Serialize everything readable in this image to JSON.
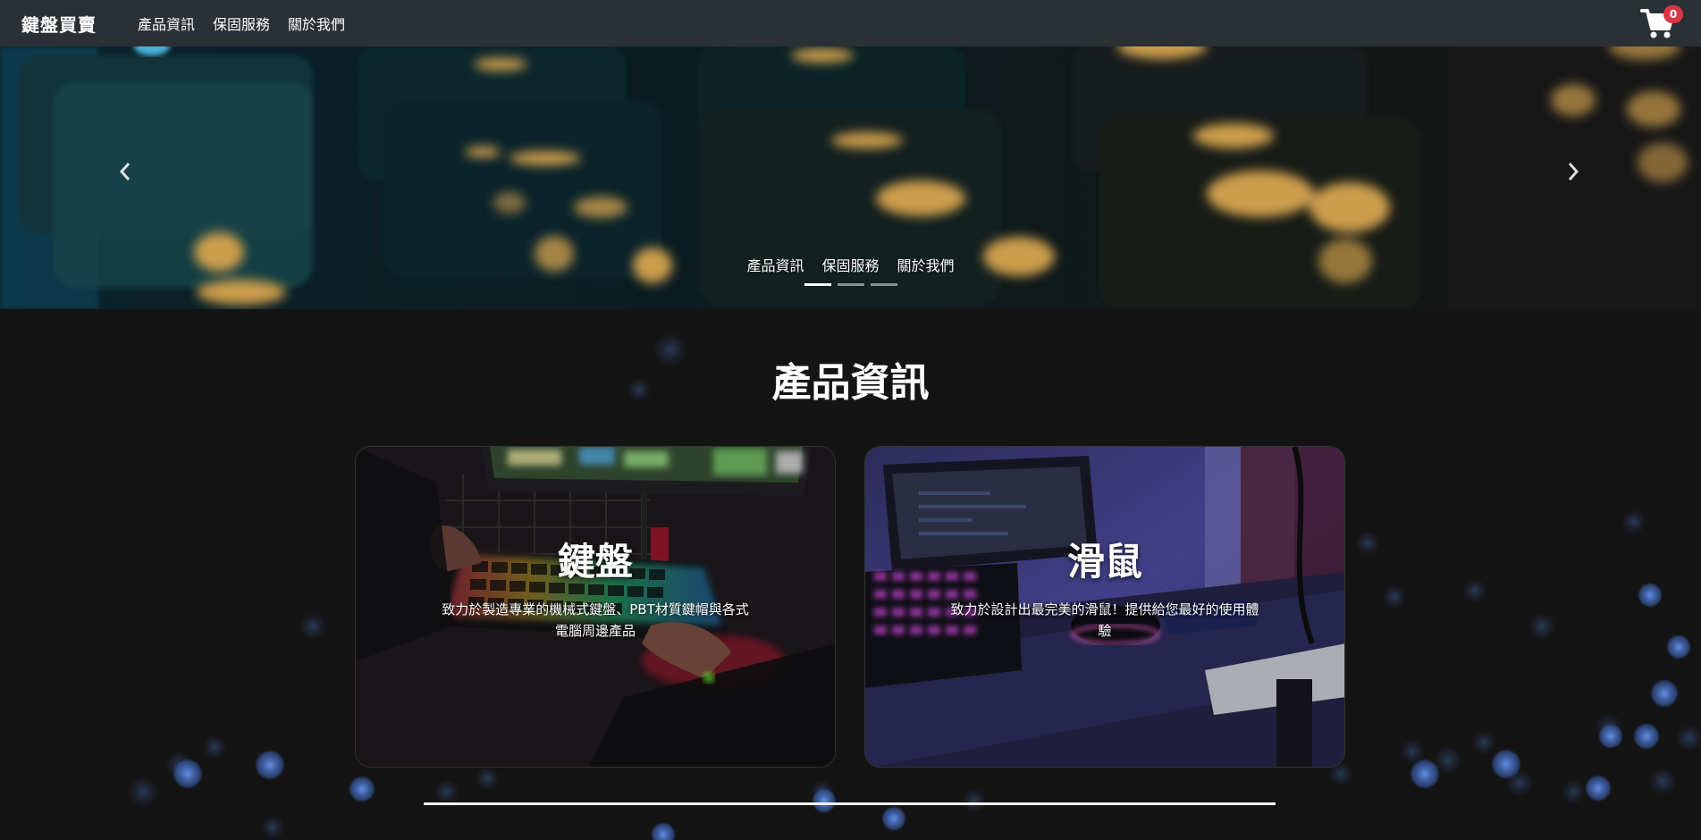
{
  "navbar": {
    "brand": "鍵盤買賣",
    "links": [
      {
        "label": "產品資訊"
      },
      {
        "label": "保固服務"
      },
      {
        "label": "關於我們"
      }
    ],
    "cart": {
      "icon": "cart-icon",
      "count": "0"
    }
  },
  "carousel": {
    "captions": [
      {
        "label": "產品資訊"
      },
      {
        "label": "保固服務"
      },
      {
        "label": "關於我們"
      }
    ],
    "slide_count": 3,
    "active_slide": 1
  },
  "products": {
    "title": "產品資訊",
    "cards": [
      {
        "title": "鍵盤",
        "text": "致力於製造專業的機械式鍵盤、PBT材質鍵帽與各式電腦周邊產品"
      },
      {
        "title": "滑鼠",
        "text": "致力於設計出最完美的滑鼠！提供給您最好的使用體驗"
      }
    ]
  },
  "colors": {
    "navbar_bg": "#2b3035",
    "page_bg": "#141414",
    "badge": "#dc3545",
    "bokeh": "#4a7fd6"
  }
}
